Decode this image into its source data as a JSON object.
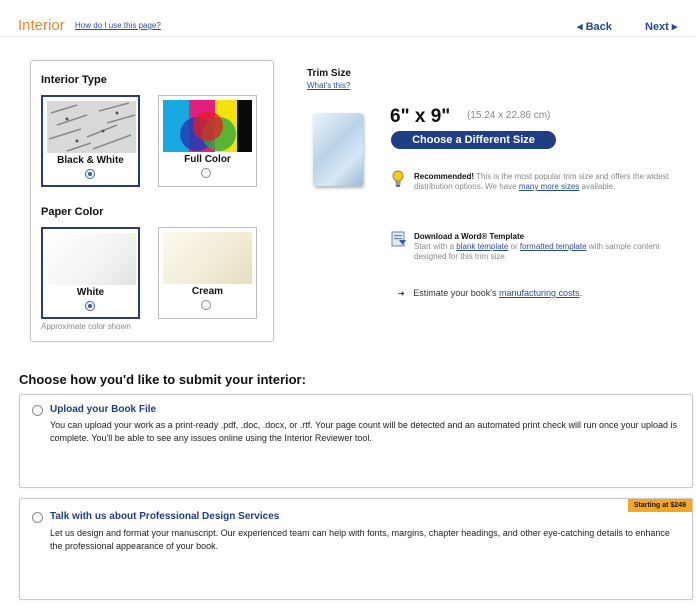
{
  "header": {
    "title": "Interior",
    "help_link": "How do I use this page?",
    "back_label": "◂ Back",
    "next_label": "Next ▸"
  },
  "interior_type": {
    "label": "Interior Type",
    "options": [
      {
        "label": "Black & White",
        "selected": true
      },
      {
        "label": "Full Color",
        "selected": false
      }
    ]
  },
  "paper_color": {
    "label": "Paper Color",
    "options": [
      {
        "label": "White",
        "selected": true
      },
      {
        "label": "Cream",
        "selected": false
      }
    ],
    "note": "Approximate color shown"
  },
  "trim": {
    "title": "Trim Size",
    "whats_this": "What's this?",
    "size": "6\" x 9\"",
    "size_cm": "(15.24 x 22.86 cm)",
    "choose_button": "Choose a Different Size"
  },
  "recommended": {
    "bold": "Recommended!",
    "text": " This is the most popular trim size and offers the widest distribution options. We have ",
    "link": "many more sizes",
    "text_end": " available."
  },
  "template": {
    "bold": "Download a Word® Template",
    "text_start": "Start with a ",
    "link1": "blank template",
    "text_mid": " or ",
    "link2": "formatted template",
    "text_end": " with sample content designed for this trim size."
  },
  "estimate": {
    "text": "Estimate your book's ",
    "link": "manufacturing costs",
    "end": "."
  },
  "submit": {
    "heading": "Choose how you'd like to submit your interior:",
    "options": [
      {
        "title": "Upload your Book File",
        "text": "You can upload your work as a print-ready .pdf, .doc, .docx, or .rtf. Your page count will be detected and an automated print check will run once your upload is complete. You'll be able to see any issues online using the Interior Reviewer tool."
      },
      {
        "title": "Talk with us about Professional Design Services",
        "badge": "Starting at $249",
        "text": "Let us design and format your manuscript. Our experienced team can help with fonts, margins, chapter headings, and other eye-catching details to enhance the professional appearance of your book."
      }
    ]
  },
  "colors": {
    "accent_orange": "#e08a2e",
    "link_blue": "#2b4e9b",
    "button_navy": "#1f3e86",
    "badge_orange": "#f5a623"
  }
}
